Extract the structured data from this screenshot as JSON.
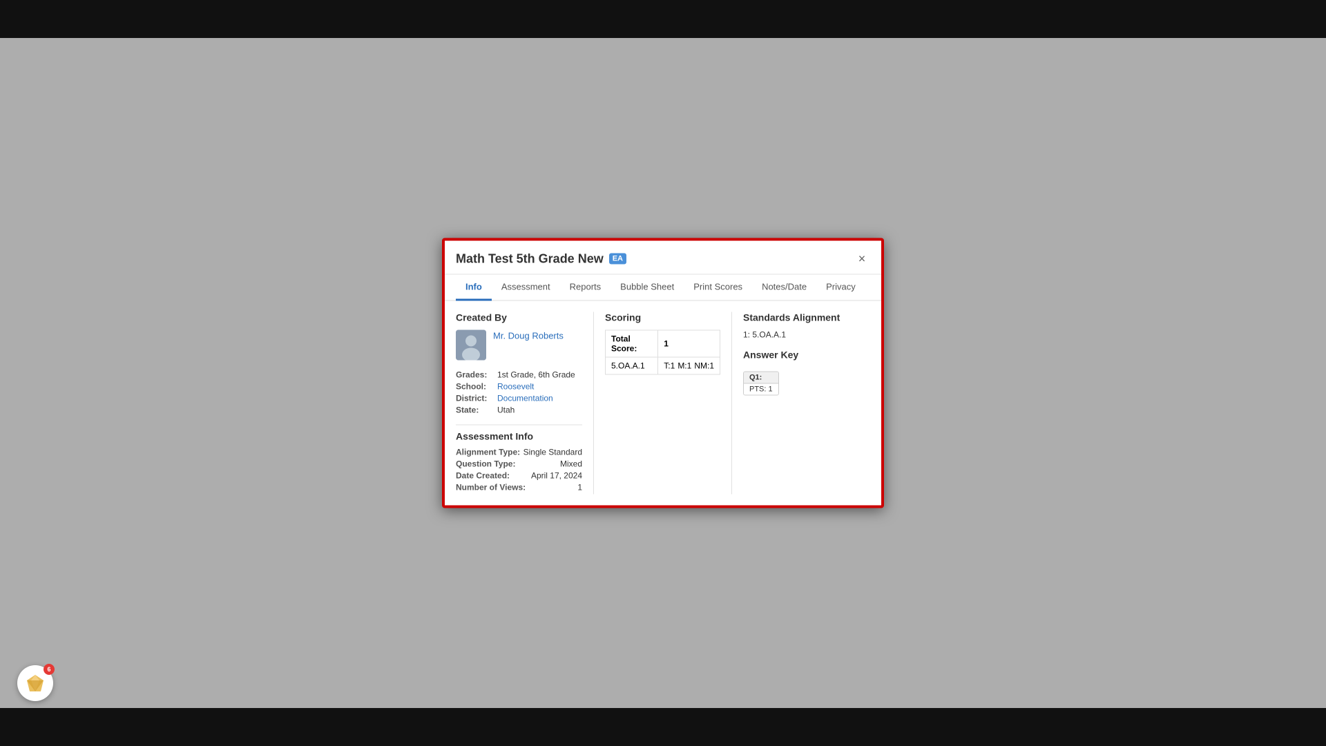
{
  "modal": {
    "title": "Math Test 5th Grade New",
    "title_badge": "EA",
    "close_label": "×",
    "tabs": [
      {
        "id": "info",
        "label": "Info",
        "active": true
      },
      {
        "id": "assessment",
        "label": "Assessment",
        "active": false
      },
      {
        "id": "reports",
        "label": "Reports",
        "active": false
      },
      {
        "id": "bubble_sheet",
        "label": "Bubble Sheet",
        "active": false
      },
      {
        "id": "print_scores",
        "label": "Print Scores",
        "active": false
      },
      {
        "id": "notes_date",
        "label": "Notes/Date",
        "active": false
      },
      {
        "id": "privacy",
        "label": "Privacy",
        "active": false
      }
    ]
  },
  "created_by": {
    "section_title": "Created By",
    "creator_name": "Mr. Doug Roberts"
  },
  "meta": {
    "grades_label": "Grades:",
    "grades_value": "1st Grade, 6th Grade",
    "school_label": "School:",
    "school_value": "Roosevelt",
    "district_label": "District:",
    "district_value": "Documentation",
    "state_label": "State:",
    "state_value": "Utah"
  },
  "assessment_info": {
    "section_title": "Assessment Info",
    "alignment_type_label": "Alignment Type:",
    "alignment_type_value": "Single Standard",
    "question_type_label": "Question Type:",
    "question_type_value": "Mixed",
    "date_created_label": "Date Created:",
    "date_created_value": "April 17, 2024",
    "num_views_label": "Number of Views:",
    "num_views_value": "1"
  },
  "scoring": {
    "section_title": "Scoring",
    "total_score_label": "Total Score:",
    "total_score_value": "1",
    "standard": "5.OA.A.1",
    "t1_label": "T:1",
    "m1_label": "M:1",
    "nm1_label": "NM:1"
  },
  "standards_alignment": {
    "section_title": "Standards Alignment",
    "items": [
      {
        "number": "1:",
        "value": "5.OA.A.1"
      }
    ]
  },
  "answer_key": {
    "section_title": "Answer Key",
    "q1_label": "Q1:",
    "q1_value": "",
    "pts_label": "PTS:",
    "pts_value": "1"
  },
  "logo": {
    "notification_count": "6"
  }
}
